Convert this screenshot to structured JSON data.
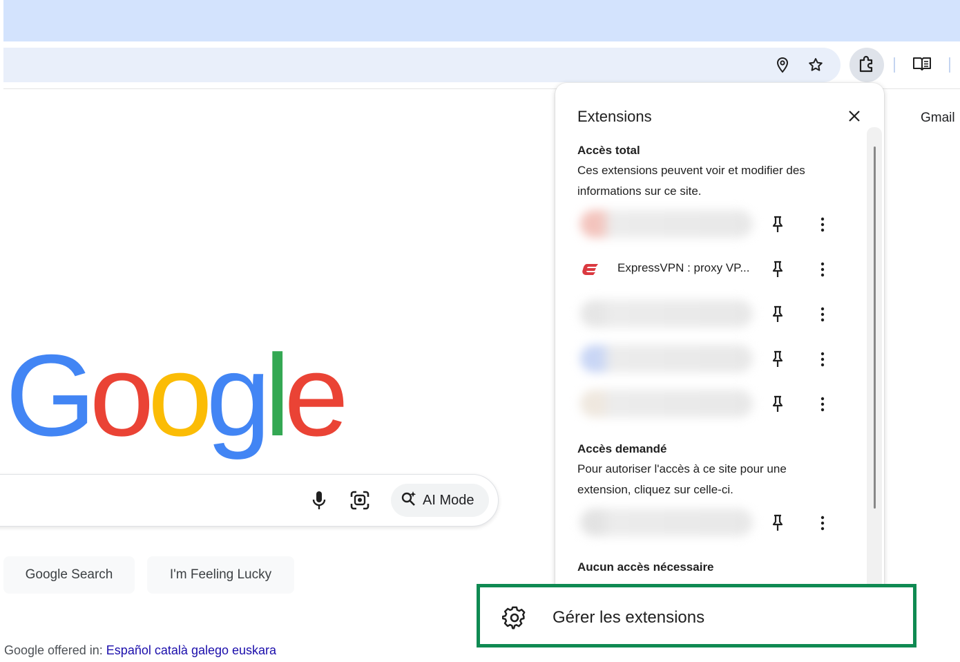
{
  "browser": {
    "extensions_button_icon": "puzzle-icon",
    "location_icon": "location-pin-icon",
    "bookmark_icon": "star-icon",
    "reading_mode_icon": "reading-mode-icon"
  },
  "google": {
    "header_link": "Gmail",
    "logo_letters": [
      {
        "char": "G",
        "color": "#4285f4"
      },
      {
        "char": "o",
        "color": "#ea4335"
      },
      {
        "char": "o",
        "color": "#fbbc05"
      },
      {
        "char": "g",
        "color": "#4285f4"
      },
      {
        "char": "l",
        "color": "#34a853"
      },
      {
        "char": "e",
        "color": "#ea4335"
      }
    ],
    "ai_mode_label": "AI Mode",
    "search_button": "Google Search",
    "lucky_button": "I'm Feeling Lucky",
    "offered_in_label": "Google offered in:",
    "languages": [
      "Español",
      "català",
      "galego",
      "euskara"
    ]
  },
  "extensions_panel": {
    "title": "Extensions",
    "full_access": {
      "heading": "Accès total",
      "description": "Ces extensions peuvent voir et modifier des informations sur ce site.",
      "items": [
        {
          "name": "",
          "blurred": true,
          "tint": "#f3c4bd"
        },
        {
          "name": "ExpressVPN : proxy VP...",
          "blurred": false,
          "icon": "expressvpn-logo-icon",
          "color": "#da3940"
        },
        {
          "name": "",
          "blurred": true,
          "tint": "#e6e6e6"
        },
        {
          "name": "",
          "blurred": true,
          "tint": "#c9d6f5"
        },
        {
          "name": "",
          "blurred": true,
          "tint": "#efe8df"
        }
      ]
    },
    "requested_access": {
      "heading": "Accès demandé",
      "description": "Pour autoriser l'accès à ce site pour une extension, cliquez sur celle-ci.",
      "items": [
        {
          "name": "",
          "blurred": true,
          "tint": "#e3e3e3"
        }
      ]
    },
    "no_access": {
      "heading": "Aucun accès nécessaire"
    },
    "manage_label": "Gérer les extensions",
    "highlight_color": "#0f8a52"
  }
}
